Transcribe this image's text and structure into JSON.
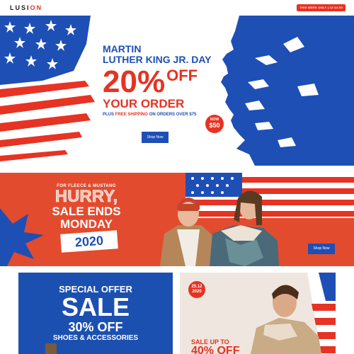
{
  "header": {
    "logo_main": "LUSI",
    "logo_accent": "ON",
    "promo": "THIS WEEK ONLY | 12:14:59"
  },
  "hero": {
    "line1": "MARTIN",
    "line2": "LUTHER KING JR. DAY",
    "percent": "20%",
    "off": "OFF",
    "your_order": "YOUR ORDER",
    "shipping_pre": "PLUS",
    "shipping_hl": "FREE SHIPPING",
    "shipping_post": "ON ORDERS OVER $75",
    "badge_l1": "NOW",
    "badge_l2": "$50",
    "button": "Shop Now"
  },
  "banner2": {
    "for": "FOR FLEECE & MUSTANG",
    "hurry": "HURRY,",
    "sale_ends": "SALE ENDS",
    "monday": "MONDAY",
    "year": "2020",
    "button": "Shop Now"
  },
  "tile_left": {
    "special": "SPECIAL OFFER",
    "sale": "SALE",
    "off": "30% OFF",
    "shoes": "SHOES & ACCESSORIES"
  },
  "tile_right": {
    "badge_date": "25.12",
    "badge_year": "2020",
    "sale_up_to": "SALE UP TO",
    "pct": "40% OFF"
  },
  "colors": {
    "red": "#e63323",
    "blue": "#1e4fb5",
    "banner_red": "#e34b2e"
  }
}
